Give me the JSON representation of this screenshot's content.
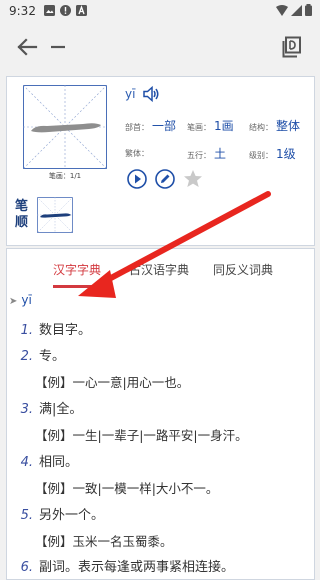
{
  "status_bar": {
    "time": "9:32"
  },
  "character": {
    "glyph": "一",
    "stroke_count_caption": "笔画：1/1",
    "pinyin": "yī",
    "attributes": [
      {
        "label": "部首：",
        "value": "一部"
      },
      {
        "label": "笔画：",
        "value": "1画"
      },
      {
        "label": "结构：",
        "value": "整体"
      },
      {
        "label": "繁体：",
        "value": ""
      },
      {
        "label": "五行：",
        "value": "土"
      },
      {
        "label": "级别：",
        "value": "1级"
      }
    ],
    "stroke_order_label": "笔顺"
  },
  "tabs": [
    {
      "label": "汉字字典",
      "active": true
    },
    {
      "label": "古汉语字典",
      "active": false
    },
    {
      "label": "同反义词典",
      "active": false
    }
  ],
  "entry": {
    "pinyin": "yī",
    "definitions": [
      {
        "num": "1.",
        "text": "数目字。",
        "example": ""
      },
      {
        "num": "2.",
        "text": "专。",
        "example": "【例】一心一意|用心一也。"
      },
      {
        "num": "3.",
        "text": "满|全。",
        "example": "【例】一生|一辈子|一路平安|一身汗。"
      },
      {
        "num": "4.",
        "text": "相同。",
        "example": "【例】一致|一模一样|大小不一。"
      },
      {
        "num": "5.",
        "text": "另外一个。",
        "example": "【例】玉米一名玉蜀黍。"
      },
      {
        "num": "6.",
        "text": "副词。表示每逢或两事紧相连接。",
        "example": ""
      }
    ]
  },
  "colors": {
    "accent_red": "#d3393f",
    "link_blue": "#1f4fa8",
    "annotation_arrow": "#e8261f"
  }
}
